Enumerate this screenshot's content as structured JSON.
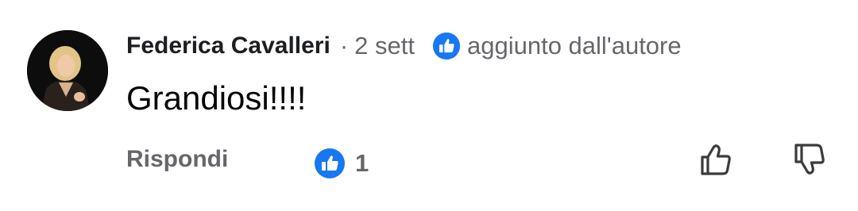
{
  "comment": {
    "author": "Federica Cavalleri",
    "separator": "·",
    "timestamp": "2 sett",
    "author_badge": "aggiunto dall'autore",
    "text": "Grandiosi!!!!",
    "reply_label": "Rispondi",
    "reaction_count": "1"
  },
  "icons": {
    "author_badge": "thumbs-up-circle-icon",
    "reaction": "thumbs-up-circle-icon",
    "upvote": "thumbs-up-outline-icon",
    "downvote": "thumbs-down-outline-icon"
  },
  "colors": {
    "reaction_blue": "#1877f2",
    "muted_text": "#65676b",
    "primary_text": "#050505"
  }
}
